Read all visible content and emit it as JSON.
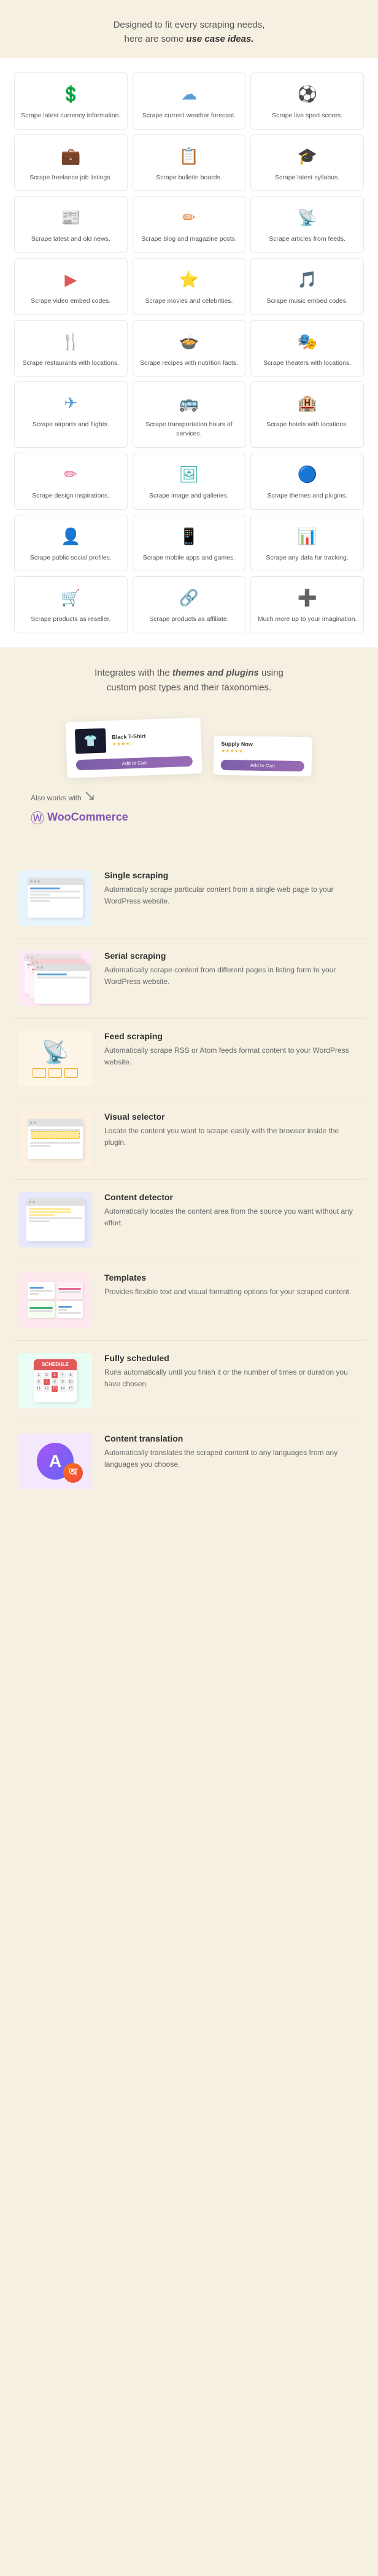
{
  "header": {
    "line1": "Designed to fit every scraping needs,",
    "line2": "here are some ",
    "line2_bold": "use case ideas."
  },
  "use_cases": [
    {
      "label": "Scrape latest currency information.",
      "icon": "💲",
      "icon_color": "icon-green"
    },
    {
      "label": "Scrape current weather forecast.",
      "icon": "☁",
      "icon_color": "icon-blue"
    },
    {
      "label": "Scrape live sport scores.",
      "icon": "⚽",
      "icon_color": "icon-orange"
    },
    {
      "label": "Scrape freelance job listings.",
      "icon": "💼",
      "icon_color": "icon-teal"
    },
    {
      "label": "Scrape bulletin boards.",
      "icon": "📋",
      "icon_color": "icon-blue"
    },
    {
      "label": "Scrape latest syllabus.",
      "icon": "🎓",
      "icon_color": "icon-purple"
    },
    {
      "label": "Scrape latest and old news.",
      "icon": "📰",
      "icon_color": "icon-teal"
    },
    {
      "label": "Scrape blog and magazine posts.",
      "icon": "✏",
      "icon_color": "icon-orange"
    },
    {
      "label": "Scrape articles from feeds.",
      "icon": "📡",
      "icon_color": "icon-red"
    },
    {
      "label": "Scrape video embed codes.",
      "icon": "▶",
      "icon_color": "icon-red"
    },
    {
      "label": "Scrape movies and celebrities.",
      "icon": "⭐",
      "icon_color": "icon-yellow"
    },
    {
      "label": "Scrape music embed codes.",
      "icon": "🎵",
      "icon_color": "icon-purple"
    },
    {
      "label": "Scrape restaurants with locations.",
      "icon": "🍴",
      "icon_color": "icon-orange"
    },
    {
      "label": "Scrape recipes with nutrition facts.",
      "icon": "🍲",
      "icon_color": "icon-green"
    },
    {
      "label": "Scrape theaters with locations.",
      "icon": "🎭",
      "icon_color": "icon-teal"
    },
    {
      "label": "Scrape airports and flights.",
      "icon": "✈",
      "icon_color": "icon-blue"
    },
    {
      "label": "Scrape transportation hours of services.",
      "icon": "🚌",
      "icon_color": "icon-green"
    },
    {
      "label": "Scrape hotels with locations.",
      "icon": "🏨",
      "icon_color": "icon-orange"
    },
    {
      "label": "Scrape design inspirations.",
      "icon": "✏",
      "icon_color": "icon-pink"
    },
    {
      "label": "Scrape image and galleries.",
      "icon": "🖼",
      "icon_color": "icon-teal"
    },
    {
      "label": "Scrape themes and plugins.",
      "icon": "🔵",
      "icon_color": "icon-blue"
    },
    {
      "label": "Scrape public social profiles.",
      "icon": "👤",
      "icon_color": "icon-purple"
    },
    {
      "label": "Scrape mobile apps and games.",
      "icon": "📱",
      "icon_color": "icon-light-blue"
    },
    {
      "label": "Scrape any data for tracking.",
      "icon": "📊",
      "icon_color": "icon-green"
    },
    {
      "label": "Scrape products as reseller.",
      "icon": "🛒",
      "icon_color": "icon-teal"
    },
    {
      "label": "Scrape products as affiliate.",
      "icon": "🔗",
      "icon_color": "icon-blue"
    },
    {
      "label": "Much more up to your imagination.",
      "icon": "➕",
      "icon_color": "icon-orange"
    }
  ],
  "integrate": {
    "line1": "Integrates with the themes and plugins using",
    "line2": "custom post types and their taxonomies.",
    "bold_part": "themes and plugins"
  },
  "product_section": {
    "product1_name": "Black T-Shirt",
    "product1_stars": "★★★★☆",
    "product2_name": "Supply Now",
    "product2_stars": "★★★★★",
    "add_to_cart": "Add to Cart",
    "also_works_label": "Also works with",
    "woocommerce_label": "WooCommerce"
  },
  "features": [
    {
      "title": "Single scraping",
      "description": "Automatically scrape particular content from a single web page to your WordPress website.",
      "type": "single"
    },
    {
      "title": "Serial scraping",
      "description": "Automatically scrape content from different pages in listing form to your WordPress website.",
      "type": "serial"
    },
    {
      "title": "Feed scraping",
      "description": "Automatically scrape RSS or Atom feeds format content to your WordPress website.",
      "type": "feed"
    },
    {
      "title": "Visual selector",
      "description": "Locate the content you want to scrape easily with the browser inside the plugin.",
      "type": "visual"
    },
    {
      "title": "Content detector",
      "description": "Automatically locates the content area from the source you want without any effort.",
      "type": "content"
    },
    {
      "title": "Templates",
      "description": "Provides flexible text and visual formatting options for your scraped content.",
      "type": "templates"
    },
    {
      "title": "Fully scheduled",
      "description": "Runs automatically until you finish it or the number of times or duration you have chosen.",
      "type": "scheduled"
    },
    {
      "title": "Content translation",
      "description": "Automatically translates the scraped content to any languages from any languages you choose.",
      "type": "translation"
    }
  ]
}
